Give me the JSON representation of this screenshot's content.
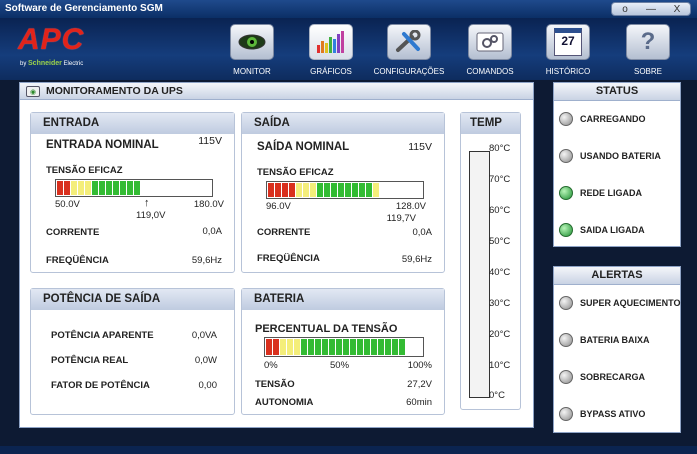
{
  "window": {
    "title": "Software de Gerenciamento SGM",
    "btn_min": "o",
    "btn_restore": "—",
    "btn_close": "X"
  },
  "logo": {
    "brand": "APC",
    "by": "by",
    "maker": "Schneider",
    "maker2": "Electric"
  },
  "nav": [
    {
      "label": "MONITOR",
      "icon": "eye-icon"
    },
    {
      "label": "GRÁFICOS",
      "icon": "bar-chart-icon"
    },
    {
      "label": "CONFIGURAÇÕES",
      "icon": "wrench-icon"
    },
    {
      "label": "COMANDOS",
      "icon": "gears-icon"
    },
    {
      "label": "HISTÓRICO",
      "icon": "calendar-icon",
      "glyph": "27"
    },
    {
      "label": "SOBRE",
      "icon": "question-icon",
      "glyph": "?"
    }
  ],
  "main": {
    "title": "MONITORAMENTO DA UPS"
  },
  "entrada": {
    "title": "ENTRADA",
    "nominal_label": "ENTRADA NOMINAL",
    "nominal_value": "115V",
    "tensao_label": "TENSÃO EFICAZ",
    "bar_min": "50.0V",
    "bar_max": "180.0V",
    "bar_current": "119,0V",
    "corrente_label": "CORRENTE",
    "corrente_value": "0,0A",
    "freq_label": "FREQÜÊNCIA",
    "freq_value": "59,6Hz"
  },
  "saida": {
    "title": "SAÍDA",
    "nominal_label": "SAÍDA NOMINAL",
    "nominal_value": "115V",
    "tensao_label": "TENSÃO EFICAZ",
    "bar_min": "96.0V",
    "bar_max": "128.0V",
    "bar_current": "119,7V",
    "corrente_label": "CORRENTE",
    "corrente_value": "0,0A",
    "freq_label": "FREQÜÊNCIA",
    "freq_value": "59,6Hz"
  },
  "potencia": {
    "title": "POTÊNCIA DE SAÍDA",
    "aparente_label": "POTÊNCIA APARENTE",
    "aparente_value": "0,0VA",
    "real_label": "POTÊNCIA REAL",
    "real_value": "0,0W",
    "fator_label": "FATOR DE POTÊNCIA",
    "fator_value": "0,00"
  },
  "bateria": {
    "title": "BATERIA",
    "percent_label": "PERCENTUAL DA TENSÃO",
    "bar_min": "0%",
    "bar_mid": "50%",
    "bar_max": "100%",
    "tensao_label": "TENSÃO",
    "tensao_value": "27,2V",
    "autonomia_label": "AUTONOMIA",
    "autonomia_value": "60min"
  },
  "temp": {
    "title": "TEMP",
    "ticks": [
      "80°C",
      "70°C",
      "60°C",
      "50°C",
      "40°C",
      "30°C",
      "20°C",
      "10°C",
      "0°C"
    ]
  },
  "status": {
    "title": "STATUS",
    "items": [
      {
        "label": "CARREGANDO",
        "state": "off"
      },
      {
        "label": "USANDO BATERIA",
        "state": "off"
      },
      {
        "label": "REDE LIGADA",
        "state": "on"
      },
      {
        "label": "SAIDA LIGADA",
        "state": "on"
      }
    ]
  },
  "alertas": {
    "title": "ALERTAS",
    "items": [
      {
        "label": "SUPER AQUECIMENTO",
        "state": "off"
      },
      {
        "label": "BATERIA BAIXA",
        "state": "off"
      },
      {
        "label": "SOBRECARGA",
        "state": "off"
      },
      {
        "label": "BYPASS ATIVO",
        "state": "off"
      }
    ]
  },
  "colors": {
    "accent_red": "#e2231a",
    "led_on": "#1d8f32",
    "header_blue": "#153d7c"
  }
}
